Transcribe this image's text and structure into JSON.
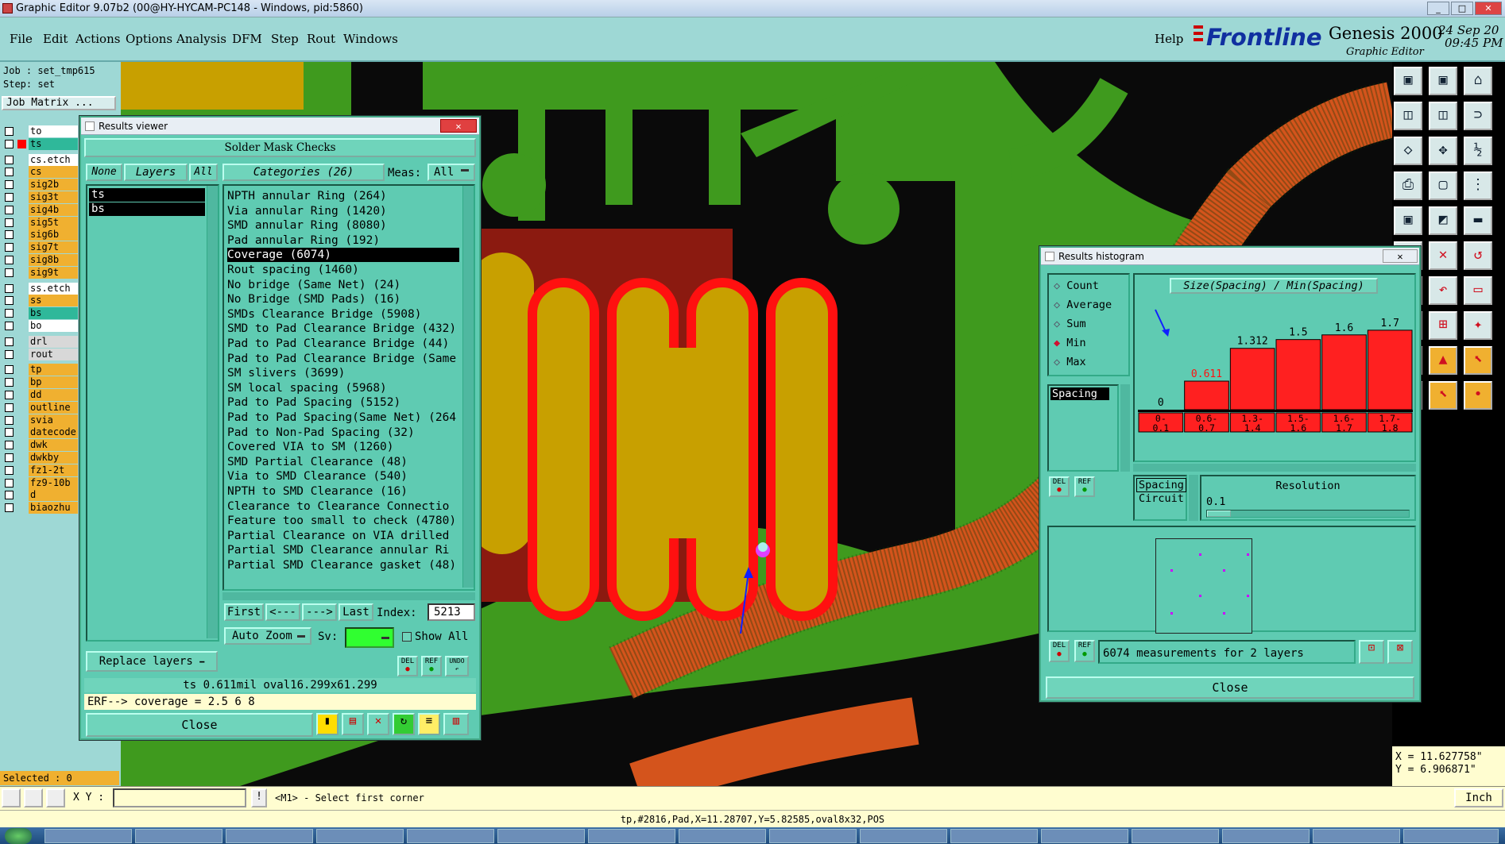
{
  "window": {
    "title": "Graphic Editor 9.07b2 (00@HY-HYCAM-PC148 - Windows, pid:5860)"
  },
  "menu": {
    "items": [
      "File",
      "Edit",
      "Actions",
      "Options",
      "Analysis",
      "DFM",
      "Step",
      "Rout",
      "Windows"
    ],
    "help": "Help"
  },
  "brand": {
    "logo": "Frontline",
    "product": "Genesis 2000",
    "subtitle": "Graphic Editor",
    "date": "24 Sep 20",
    "time": "09:45 PM"
  },
  "job": {
    "job_label": "Job : set_tmp615",
    "step_label": "Step: set",
    "matrix_button": "Job Matrix ..."
  },
  "layers": [
    "to",
    "ts",
    "cs.etch",
    "cs",
    "sig2b",
    "sig3t",
    "sig4b",
    "sig5t",
    "sig6b",
    "sig7t",
    "sig8b",
    "sig9t",
    "ss.etch",
    "ss",
    "bs",
    "bo",
    "drl",
    "rout",
    "tp",
    "bp",
    "dd",
    "outline",
    "svia",
    "datecode",
    "dwk",
    "dwkby",
    "fz1-2t",
    "fz9-10b",
    "d",
    "biaozhu"
  ],
  "selected": "Selected : 0",
  "results_viewer": {
    "title": "Results viewer",
    "header": "Solder Mask Checks",
    "none_btn": "None",
    "layers_btn": "Layers",
    "all_btn": "All",
    "categories_btn": "Categories (26)",
    "meas_label": "Meas:",
    "meas_value": "All",
    "layer_list": [
      "ts",
      "bs"
    ],
    "categories": [
      "NPTH annular Ring (264)",
      "Via annular Ring (1420)",
      "SMD annular Ring (8080)",
      "Pad annular Ring (192)",
      "Coverage (6074)",
      "Rout spacing (1460)",
      "No bridge (Same Net) (24)",
      "No Bridge (SMD Pads) (16)",
      "SMDs Clearance Bridge (5908)",
      "SMD to Pad Clearance Bridge (432)",
      "Pad to Pad Clearance Bridge (44)",
      "Pad to Pad Clearance Bridge (Same",
      "SM slivers (3699)",
      "SM local spacing (5968)",
      "Pad to Pad Spacing (5152)",
      "Pad to Pad Spacing(Same Net) (264",
      "Pad to Non-Pad Spacing (32)",
      "Covered VIA to SM (1260)",
      "SMD Partial Clearance (48)",
      "Via to SMD Clearance (540)",
      "NPTH to SMD Clearance (16)",
      "Clearance to Clearance Connectio",
      "Feature too small to check (4780)",
      "Partial Clearance on VIA drilled",
      "Partial SMD Clearance annular Ri",
      "Partial SMD Clearance gasket (48)"
    ],
    "selected_category": 4,
    "nav": {
      "first": "First",
      "prev": "<---",
      "next": "--->",
      "last": "Last",
      "index_label": "Index:",
      "index_value": "5213"
    },
    "auto_zoom": "Auto Zoom",
    "sv_label": "Sv:",
    "show_all": "Show All",
    "replace_layers": "Replace layers",
    "del": "DEL",
    "ref": "REF",
    "undo": "UNDO",
    "measurement": "ts 0.611mil  oval16.299x61.299",
    "erf": "ERF--> coverage = 2.5 6 8",
    "close": "Close"
  },
  "histogram": {
    "title": "Results histogram",
    "modes": [
      "Count",
      "Average",
      "Sum",
      "Min",
      "Max"
    ],
    "selected_mode": "Min",
    "chart_title": "Size(Spacing) / Min(Spacing)",
    "measure_list": [
      "Spacing"
    ],
    "chart_data": {
      "type": "bar",
      "title": "Size(Spacing) / Min(Spacing)",
      "categories": [
        "0-0.1",
        "0.6-0.7",
        "1.3-1.4",
        "1.5-1.6",
        "1.6-1.7",
        "1.7-1.8"
      ],
      "values": [
        0,
        0.611,
        1.312,
        1.5,
        1.6,
        1.7
      ],
      "value_labels": [
        "0",
        "0.611",
        "1.312",
        "1.5",
        "1.6",
        "1.7"
      ],
      "ylim": [
        0,
        1.8
      ]
    },
    "range_labels": [
      [
        "0-",
        "0.1"
      ],
      [
        "0.6-",
        "0.7"
      ],
      [
        "1.3-",
        "1.4"
      ],
      [
        "1.5-",
        "1.6"
      ],
      [
        "1.6-",
        "1.7"
      ],
      [
        "1.7-",
        "1.8"
      ]
    ],
    "type_list": [
      "Spacing",
      "Circuit"
    ],
    "resolution_label": "Resolution",
    "resolution_value": "0.1",
    "del": "DEL",
    "ref": "REF",
    "summary": "6074 measurements for 2 layers",
    "close": "Close"
  },
  "coords": {
    "x": "X = 11.627758\"",
    "y": "Y = 6.906871\""
  },
  "command": {
    "xy_label": "X Y :",
    "prompt": "<M1> - Select first corner",
    "units": "Inch"
  },
  "status": "tp,#2816,Pad,X=11.28707,Y=5.82585,oval8x32,POS",
  "colors": {
    "ui_teal": "#9ed8d5",
    "dialog": "#5fcbb2",
    "board_green": "#3f9a1e",
    "copper": "#d4541c",
    "pad_gold": "#c8a000",
    "bar_red": "#ff2020"
  }
}
